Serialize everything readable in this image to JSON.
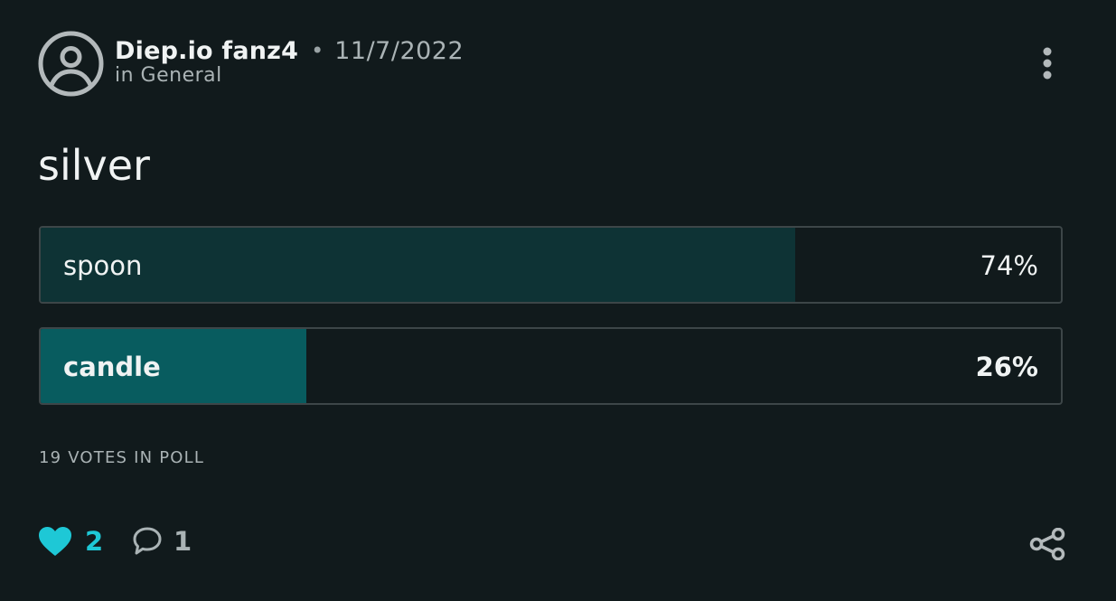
{
  "post": {
    "author": "Diep.io fanz4",
    "separator": "•",
    "date": "11/7/2022",
    "category": "in General",
    "title": "silver",
    "avatar_icon": "user-circle-icon",
    "more_icon": "more-vertical-icon"
  },
  "poll": {
    "options": [
      {
        "label": "spoon",
        "percent_label": "74%",
        "percent": 74,
        "selected": false,
        "fill_color": "#0e3335"
      },
      {
        "label": "candle",
        "percent_label": "26%",
        "percent": 26,
        "selected": true,
        "fill_color": "#085c5f"
      }
    ],
    "votes_label": "19 VOTES IN POLL"
  },
  "footer": {
    "likes": "2",
    "like_icon": "heart-icon",
    "like_color": "#1ec8d6",
    "comments": "1",
    "comment_icon": "comment-icon",
    "share_icon": "share-icon"
  }
}
